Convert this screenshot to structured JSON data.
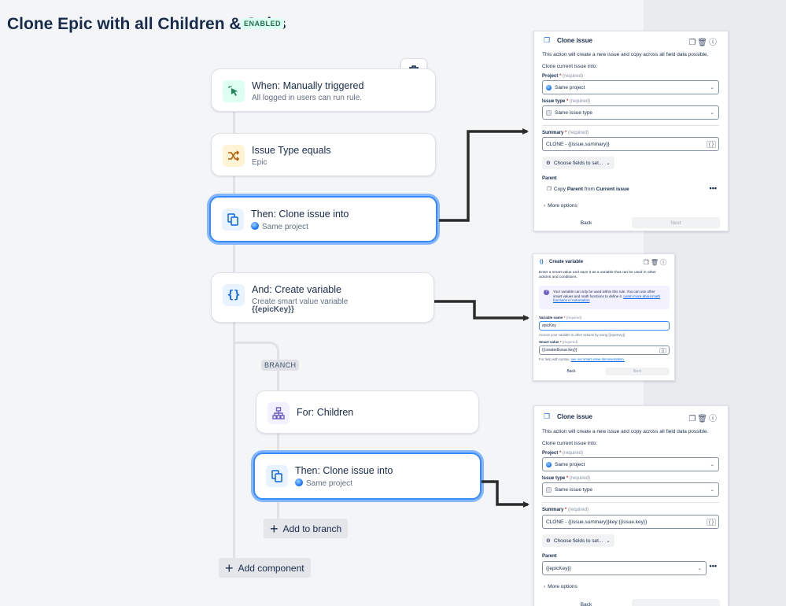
{
  "page": {
    "title": "Clone Epic with all Children & Subs",
    "status_badge": "ENABLED"
  },
  "flow": {
    "trigger": {
      "title": "When: Manually triggered",
      "subtitle": "All logged in users can run rule.",
      "icon": "cursor-click-icon"
    },
    "condition": {
      "title": "Issue Type equals",
      "subtitle": "Epic",
      "icon": "shuffle-icon"
    },
    "clone_action": {
      "title": "Then: Clone issue into",
      "subtitle": "Same project",
      "icon": "copy-icon"
    },
    "create_variable": {
      "title": "And: Create variable",
      "subtitle": "Create smart value variable",
      "value": "{{epicKey}}",
      "icon": "braces-icon"
    },
    "branch_label": "BRANCH",
    "branch_for": {
      "title": "For: Children",
      "icon": "hierarchy-icon"
    },
    "branch_clone": {
      "title": "Then: Clone issue into",
      "subtitle": "Same project",
      "icon": "copy-icon"
    },
    "add_to_branch": "Add to branch",
    "add_component": "Add component"
  },
  "panel1": {
    "title": "Clone issue",
    "description": "This action will create a new issue and copy across all field data possible.",
    "clone_into_label": "Clone current issue into:",
    "project_label": "Project",
    "project_value": "Same project",
    "issue_type_label": "Issue type",
    "issue_type_value": "Same issue type",
    "summary_label": "Summary",
    "summary_value": "CLONE - {{issue.summary}}",
    "required": "(required)",
    "choose_fields": "Choose fields to set...",
    "parent_label": "Parent",
    "parent_copy_prefix": "Copy",
    "parent_copy_bold1": "Parent",
    "parent_copy_mid": "from",
    "parent_copy_bold2": "Current issue",
    "more_options": "More options",
    "back": "Back",
    "next": "Next"
  },
  "panel2": {
    "title": "Create variable",
    "description": "Enter a smart value and save it as a variable that can be used in other actions and conditions.",
    "info_text": "Your variable can only be used within this rule. You can use other smart values and math functions to define it.",
    "info_link": "Learn more about math functions in Automation",
    "variable_name_label": "Variable name",
    "variable_name_value": "epicKey",
    "variable_hint": "Access your variable in other actions by using {{epicKey}}",
    "smart_value_label": "Smart value",
    "smart_value_value": "{{createdIssue.key}}",
    "syntax_help_prefix": "For help with syntax,",
    "syntax_help_link": "see our smart value documentation.",
    "required": "(required)",
    "back": "Back",
    "next": "Next"
  },
  "panel3": {
    "title": "Clone issue",
    "description": "This action will create a new issue and copy across all field data possible.",
    "clone_into_label": "Clone current issue into:",
    "project_label": "Project",
    "project_value": "Same project",
    "issue_type_label": "Issue type",
    "issue_type_value": "Same issue type",
    "summary_label": "Summary",
    "summary_value": "CLONE - {{issue.summary}}key:{{issue.key}}",
    "required": "(required)",
    "choose_fields": "Choose fields to set...",
    "parent_label": "Parent",
    "parent_value": "{{epicKey}}",
    "more_options": "More options",
    "back": "Back"
  },
  "colors": {
    "selected_border": "#388bff",
    "badge_bg": "#dcfff1",
    "badge_text": "#216e4e",
    "arrow": "#2b2b2b"
  }
}
